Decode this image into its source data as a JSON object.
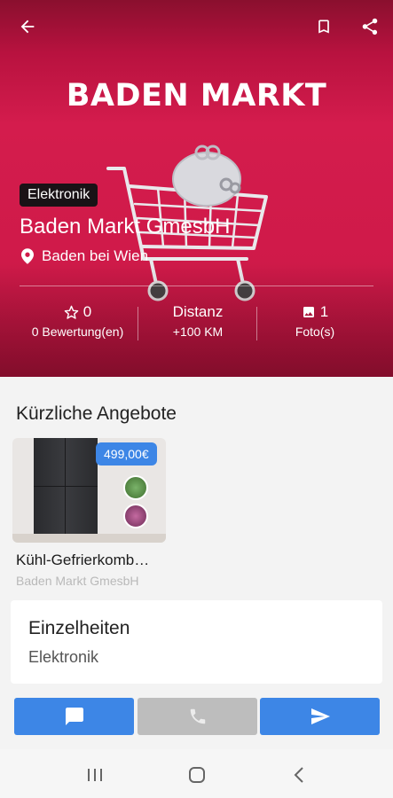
{
  "header": {
    "back_icon": "arrow-left-icon",
    "bookmark_icon": "bookmark-icon",
    "share_icon": "share-icon",
    "brand_logo_text": "BADEN MARKT",
    "category_badge": "Elektronik",
    "store_name": "Baden Markt GmesbH",
    "location": "Baden bei Wien"
  },
  "stats": {
    "rating_value": "0",
    "rating_label": "0 Bewertung(en)",
    "distance_title": "Distanz",
    "distance_value": "+100 KM",
    "photos_value": "1",
    "photos_label": "Foto(s)"
  },
  "offers": {
    "section_title": "Kürzliche Angebote",
    "items": [
      {
        "price": "499,00€",
        "title": "Kühl-Gefrierkomb…",
        "store": "Baden Markt GmesbH"
      }
    ]
  },
  "details": {
    "title": "Einzelheiten",
    "value": "Elektronik"
  },
  "actions": {
    "chat_icon": "chat-icon",
    "call_icon": "phone-icon",
    "send_icon": "send-icon"
  },
  "colors": {
    "hero_red": "#cf1a49",
    "accent_blue": "#3d86e6",
    "disabled_gray": "#bdbdbd"
  },
  "navbar": {
    "recents_icon": "recents-icon",
    "home_icon": "home-icon",
    "back_icon": "nav-back-icon"
  }
}
